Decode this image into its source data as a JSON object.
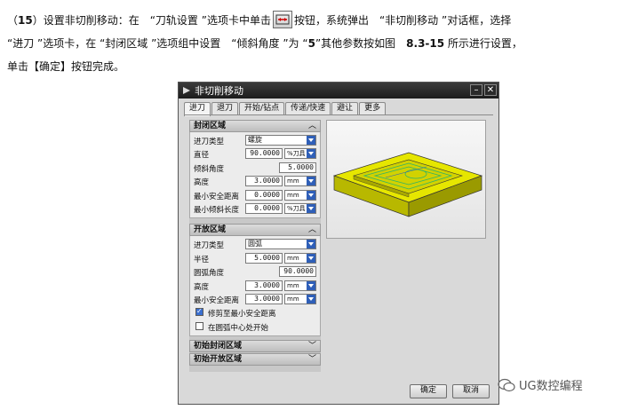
{
  "paragraph": {
    "l1_a": "（",
    "l1_num": "15",
    "l1_b": "）设置非切削移动：在　“刀轨设置 ”选项卡中单击",
    "l1_c": "按钮，系统弹出　“非切削移动 ”对话框，选择",
    "l2_a": "“进刀 ”选项卡，在 “封闭区域 ”选项组中设置　“倾斜角度 ”为 “",
    "l2_num": "5",
    "l2_b": "”其他参数按如图　",
    "l2_fig": "8.3-15",
    "l2_c": " 所示进行设置，",
    "l3": "单击【确定】按钮完成。"
  },
  "dialog": {
    "title": "非切削移动",
    "tabs": [
      "进刀",
      "退刀",
      "开始/钻点",
      "传递/快速",
      "避让",
      "更多"
    ],
    "closed_section": {
      "title": "封闭区域",
      "rows": [
        {
          "label": "进刀类型",
          "value": "螺旋"
        },
        {
          "label": "直径",
          "value": "90.0000",
          "unit": "%刀具"
        },
        {
          "label": "倾斜角度",
          "value": "5.0000"
        },
        {
          "label": "高度",
          "value": "3.0000",
          "unit": "mm"
        },
        {
          "label": "最小安全距离",
          "value": "0.0000",
          "unit": "mm"
        },
        {
          "label": "最小倾斜长度",
          "value": "0.0000",
          "unit": "%刀具"
        }
      ]
    },
    "open_section": {
      "title": "开放区域",
      "rows": [
        {
          "label": "进刀类型",
          "value": "圆弧"
        },
        {
          "label": "半径",
          "value": "5.0000",
          "unit": "mm"
        },
        {
          "label": "圆弧角度",
          "value": "90.0000"
        },
        {
          "label": "高度",
          "value": "3.0000",
          "unit": "mm"
        },
        {
          "label": "最小安全距离",
          "value": "3.0000",
          "unit": "mm"
        }
      ],
      "checkbox1": "修剪至最小安全距离",
      "checkbox1_checked": true,
      "checkbox2": "在圆弧中心处开始",
      "checkbox2_checked": false
    },
    "initial_closed": "初始封闭区域",
    "initial_open": "初始开放区域",
    "ok": "确定",
    "cancel": "取消"
  },
  "watermark": "UG数控编程",
  "colors": {
    "part": "#e6e600",
    "dropdown": "#2f5fb8",
    "toolpath": "#2fb36a"
  }
}
